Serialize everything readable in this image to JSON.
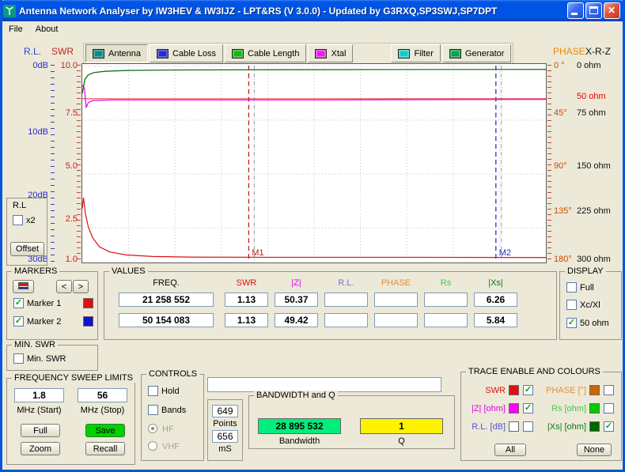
{
  "window": {
    "title": "Antenna Network Analyser by IW3HEV & IW3IJZ - LPT&RS (V 3.0.0) - Updated by G3RXQ,SP3SWJ,SP7DPT"
  },
  "menu": {
    "items": [
      {
        "label": "File"
      },
      {
        "label": "About"
      }
    ]
  },
  "toolbar": {
    "rl_label": "R.L.",
    "swr_label": "SWR",
    "phase_label": "PHASE",
    "xrz_label": "X-R-Z",
    "buttons": [
      {
        "label": "Antenna",
        "icon": "antenna-icon",
        "icon_color": "#0b8a86",
        "active": true
      },
      {
        "label": "Cable Loss",
        "icon": "cable-loss-icon",
        "icon_color": "#2a2ad2",
        "active": false
      },
      {
        "label": "Cable Length",
        "icon": "cable-length-icon",
        "icon_color": "#17b517",
        "active": false
      },
      {
        "label": "Xtal",
        "icon": "xtal-icon",
        "icon_color": "#e820e8",
        "active": false
      },
      {
        "label": "Filter",
        "icon": "filter-icon",
        "icon_color": "#19c9c9",
        "active": false
      },
      {
        "label": "Generator",
        "icon": "generator-icon",
        "icon_color": "#0ba04b",
        "active": false
      }
    ]
  },
  "chart_data": {
    "type": "line",
    "x_axis": {
      "unit": "MHz",
      "min_mhz": 1.8,
      "max_mhz": 56
    },
    "y_axes": {
      "swr": {
        "min": 1,
        "max": 10,
        "ticks": [
          10,
          7.5,
          5,
          2.5,
          1
        ]
      },
      "rl_db": {
        "ticks": [
          0,
          10,
          20,
          30
        ]
      },
      "ohm": {
        "min": 0,
        "max": 300,
        "ticks": [
          0,
          50,
          75,
          150,
          225,
          300
        ]
      },
      "phase_deg": {
        "ticks": [
          0,
          45,
          90,
          135,
          180
        ]
      }
    },
    "axes_labels": {
      "swr": [
        "10.0",
        "7.5",
        "5.0",
        "2.5",
        "1.0"
      ],
      "db": [
        "0dB",
        "10dB",
        "20dB",
        "30dB"
      ],
      "deg": [
        "0 °",
        "45°",
        "90°",
        "135°",
        "180°"
      ],
      "ohm": [
        "0 ohm",
        "75 ohm",
        "150 ohm",
        "225 ohm",
        "300 ohm"
      ],
      "ohm_ref": "50 ohm"
    },
    "swr_gridlines": [
      10,
      7.5,
      5,
      2.5
    ],
    "ref_line_ohm": 50,
    "markers": [
      {
        "name": "M1",
        "mhz": 21.258552,
        "color": "#bb2020"
      },
      {
        "name": "M2",
        "mhz": 50.154083,
        "color": "#2233bb"
      }
    ],
    "aux_markers_mhz": [
      21.9,
      50.8
    ],
    "series": [
      {
        "name": "SWR",
        "scale": "swr",
        "color": "#dd1111",
        "points": [
          [
            1.8,
            3.4
          ],
          [
            1.95,
            3.9
          ],
          [
            2.15,
            3.2
          ],
          [
            2.5,
            2.55
          ],
          [
            3.0,
            2.05
          ],
          [
            3.8,
            1.62
          ],
          [
            5.0,
            1.38
          ],
          [
            7.0,
            1.24
          ],
          [
            10,
            1.17
          ],
          [
            15,
            1.14
          ],
          [
            25,
            1.13
          ],
          [
            40,
            1.13
          ],
          [
            56,
            1.12
          ]
        ]
      },
      {
        "name": "|Z| [ohm]",
        "scale": "ohm",
        "color": "#e300e3",
        "points": [
          [
            1.8,
            29
          ],
          [
            2.05,
            34
          ],
          [
            2.25,
            64
          ],
          [
            2.5,
            56
          ],
          [
            3.0,
            53
          ],
          [
            5,
            52
          ],
          [
            10,
            52
          ],
          [
            30,
            52
          ],
          [
            56,
            51
          ]
        ]
      },
      {
        "name": "|Xs| [ohm]",
        "scale": "ohm",
        "color": "#006600",
        "points": [
          [
            1.8,
            42
          ],
          [
            2.1,
            20
          ],
          [
            2.5,
            13
          ],
          [
            3.2,
            9.5
          ],
          [
            4.5,
            7.5
          ],
          [
            7,
            6.3
          ],
          [
            12,
            5.6
          ],
          [
            25,
            5.1
          ],
          [
            56,
            4.6
          ]
        ]
      }
    ]
  },
  "rl_box": {
    "label": "R.L",
    "x2_label": "x2",
    "x2_checked": false,
    "offset_label": "Offset"
  },
  "markers_panel": {
    "title": "MARKERS",
    "nav": {
      "prev": "<",
      "next": ">"
    },
    "items": [
      {
        "label": "Marker 1",
        "checked": true,
        "color": "#dd1111"
      },
      {
        "label": "Marker 2",
        "checked": true,
        "color": "#1111cc"
      }
    ]
  },
  "values_panel": {
    "title": "VALUES",
    "headers": [
      {
        "label": "FREQ.",
        "color": "#000000"
      },
      {
        "label": "SWR",
        "color": "#dd1111"
      },
      {
        "label": "|Z|",
        "color": "#e300e3"
      },
      {
        "label": "R.L.",
        "color": "#7070cc"
      },
      {
        "label": "PHASE",
        "color": "#e09040"
      },
      {
        "label": "Rs",
        "color": "#4cc44c"
      },
      {
        "label": "|Xs|",
        "color": "#0a7a0a"
      }
    ],
    "rows": [
      {
        "freq": "21 258 552",
        "swr": "1.13",
        "z": "50.37",
        "rl": "",
        "phase": "",
        "rs": "",
        "xs": "6.26"
      },
      {
        "freq": "50 154 083",
        "swr": "1.13",
        "z": "49.42",
        "rl": "",
        "phase": "",
        "rs": "",
        "xs": "5.84"
      }
    ]
  },
  "display_panel": {
    "title": "DISPLAY",
    "items": [
      {
        "label": "Full",
        "checked": false
      },
      {
        "label": "Xc/Xl",
        "checked": false
      },
      {
        "label": "50 ohm",
        "checked": true
      }
    ]
  },
  "min_swr_panel": {
    "title": "MIN. SWR",
    "label": "Min. SWR",
    "checked": false
  },
  "freq_panel": {
    "title": "FREQUENCY SWEEP LIMITS",
    "start_value": "1.8",
    "stop_value": "56",
    "start_label": "MHz (Start)",
    "stop_label": "MHz (Stop)",
    "buttons": {
      "full": "Full",
      "save": "Save",
      "zoom": "Zoom",
      "recall": "Recall"
    },
    "save_color": "#00d200"
  },
  "controls_panel": {
    "title": "CONTROLS",
    "checkboxes": [
      {
        "label": "Hold",
        "checked": false
      },
      {
        "label": "Bands",
        "checked": false
      }
    ],
    "radios": [
      {
        "label": "HF",
        "selected": true
      },
      {
        "label": "VHF",
        "selected": false
      }
    ]
  },
  "points_panel": {
    "points_value": "649",
    "points_label": "Points",
    "ms_value": "656",
    "ms_label": "mS"
  },
  "command_input": {
    "value": ""
  },
  "bandwidth_panel": {
    "title": "BANDWIDTH and Q",
    "bandwidth_value": "28 895 532",
    "bandwidth_label": "Bandwidth",
    "bandwidth_color": "#00ee7c",
    "q_value": "1",
    "q_label": "Q",
    "q_color": "#fff200"
  },
  "trace_panel": {
    "title": "TRACE ENABLE AND COLOURS",
    "items": [
      {
        "label": "SWR",
        "text_color": "#dd1111",
        "swatch": "#dd1111",
        "checked": true
      },
      {
        "label": "PHASE [°]",
        "text_color": "#e09040",
        "swatch": "#cc6600",
        "checked": false
      },
      {
        "label": "|Z| [ohm]",
        "text_color": "#e300e3",
        "swatch": "#ff00ff",
        "checked": true
      },
      {
        "label": "Rs [ohm]",
        "text_color": "#4cc44c",
        "swatch": "#00cc00",
        "checked": false
      },
      {
        "label": "R.L. [dB]",
        "text_color": "#5555cc",
        "swatch": "#ffffff",
        "checked": false
      },
      {
        "label": "|Xs| [ohm]",
        "text_color": "#0a7a0a",
        "swatch": "#006600",
        "checked": true
      }
    ],
    "buttons": {
      "all": "All",
      "none": "None"
    }
  }
}
